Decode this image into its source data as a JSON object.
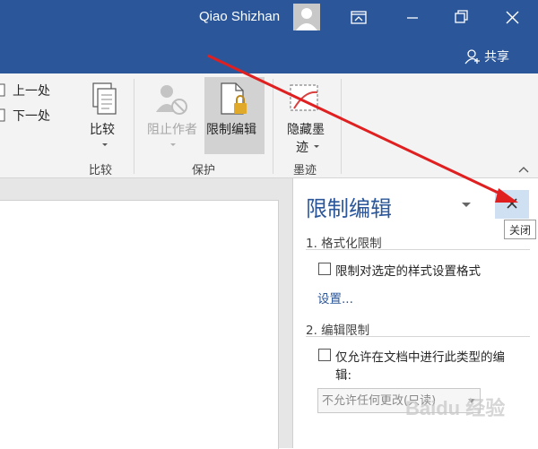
{
  "titlebar": {
    "username": "Qiao Shizhan",
    "share_label": "共享"
  },
  "ribbon": {
    "nav": {
      "prev_label": "上一处",
      "next_label": "下一处"
    },
    "compare": {
      "button_label": "比较",
      "group_label": "比较"
    },
    "protect": {
      "block_authors_label": "阻止作者",
      "restrict_editing_label": "限制编辑",
      "group_label": "保护"
    },
    "ink": {
      "hide_ink_label_line1": "隐藏墨",
      "hide_ink_label_line2": "迹",
      "group_label": "墨迹"
    }
  },
  "pane": {
    "title": "限制编辑",
    "close_tooltip": "关闭",
    "section1": {
      "heading": "1. 格式化限制",
      "checkbox_label": "限制对选定的样式设置格式",
      "checked": false,
      "settings_link": "设置..."
    },
    "section2": {
      "heading": "2. 编辑限制",
      "checkbox_label_line1": "仅允许在文档中进行此类型的编",
      "checkbox_label_line2": "辑:",
      "checked": false,
      "select_value": "不允许任何更改(只读)"
    }
  },
  "watermark": "Baidu 经验",
  "colors": {
    "titlebar": "#2b579a",
    "ribbon": "#f3f3f3",
    "accent": "#2b579a",
    "annotation_arrow": "#e02020"
  }
}
